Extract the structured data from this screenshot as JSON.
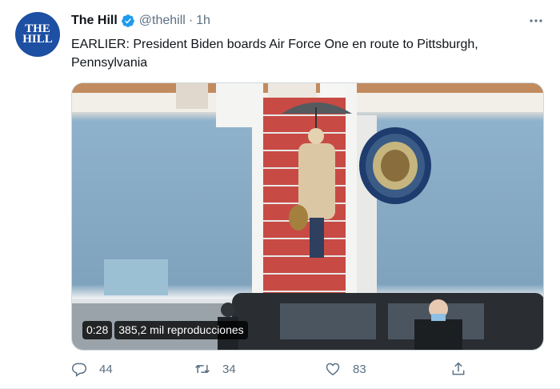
{
  "tweet": {
    "avatar_line1": "THE",
    "avatar_line2": "HILL",
    "name": "The Hill",
    "handle": "@thehill",
    "separator": "·",
    "time": "1h",
    "text": "EARLIER: President Biden boards Air Force One en route to Pittsburgh, Pennsylvania"
  },
  "video": {
    "duration": "0:28",
    "views": "385,2 mil reproducciones"
  },
  "actions": {
    "replies": "44",
    "retweets": "34",
    "likes": "83"
  },
  "colors": {
    "brand_blue": "#1d9bf0",
    "avatar_blue": "#1d4fa3",
    "muted": "#5b7083"
  },
  "icons": [
    "verified-badge-icon",
    "more-icon",
    "reply-icon",
    "retweet-icon",
    "like-icon",
    "share-icon"
  ]
}
